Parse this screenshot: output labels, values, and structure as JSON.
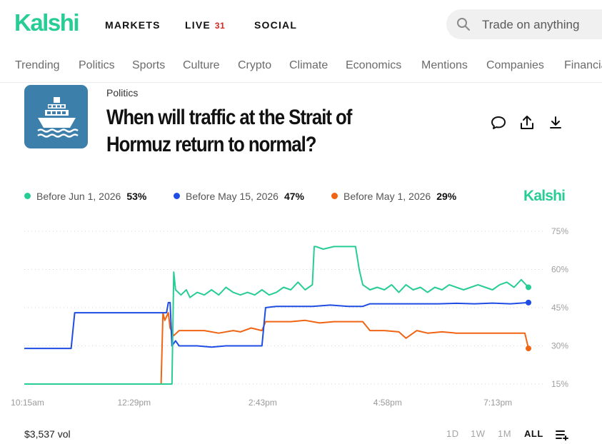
{
  "header": {
    "logo": "Kalshi",
    "nav": [
      {
        "label": "MARKETS"
      },
      {
        "label": "LIVE",
        "count": "31"
      },
      {
        "label": "SOCIAL"
      }
    ],
    "search_placeholder": "Trade on anything"
  },
  "categories": [
    "Trending",
    "Politics",
    "Sports",
    "Culture",
    "Crypto",
    "Climate",
    "Economics",
    "Mentions",
    "Companies",
    "Financials"
  ],
  "market": {
    "category": "Politics",
    "title": "When will traffic at the Strait of Hormuz return to normal?",
    "icon": "ship-icon",
    "actions": [
      "comment-icon",
      "share-icon",
      "download-icon"
    ]
  },
  "legend": {
    "items": [
      {
        "label": "Before Jun 1, 2026",
        "pct": "53%",
        "color": "#28cc95"
      },
      {
        "label": "Before May 15, 2026",
        "pct": "47%",
        "color": "#1f4de4"
      },
      {
        "label": "Before May 1, 2026",
        "pct": "29%",
        "color": "#f06414"
      }
    ],
    "brand": "Kalshi"
  },
  "chart_data": {
    "type": "line",
    "y_ticks": [
      15,
      30,
      45,
      60,
      75
    ],
    "y_tick_labels": [
      "15%",
      "30%",
      "45%",
      "60%",
      "75%"
    ],
    "ylim": [
      15,
      75
    ],
    "x_ticks": [
      {
        "label": "10:15am",
        "x": 0.09
      },
      {
        "label": "12:29pm",
        "x": 3.05
      },
      {
        "label": "2:43pm",
        "x": 6.62
      },
      {
        "label": "4:58pm",
        "x": 10.09
      },
      {
        "label": "7:13pm",
        "x": 13.15
      }
    ],
    "xlim": [
      0,
      14
    ],
    "series": [
      {
        "name": "Before Jun 1, 2026",
        "color": "#28cc95",
        "x": [
          0,
          3.9,
          4.1,
          4.15,
          4.2,
          4.35,
          4.5,
          4.6,
          4.8,
          5.0,
          5.2,
          5.4,
          5.6,
          5.8,
          6.0,
          6.2,
          6.4,
          6.6,
          6.8,
          7.0,
          7.2,
          7.4,
          7.6,
          7.8,
          8.0,
          8.05,
          8.1,
          8.3,
          8.6,
          8.9,
          9.2,
          9.3,
          9.4,
          9.6,
          9.8,
          10.0,
          10.2,
          10.4,
          10.6,
          10.8,
          11.0,
          11.2,
          11.4,
          11.6,
          11.8,
          12.0,
          12.2,
          12.4,
          12.6,
          12.8,
          13.0,
          13.2,
          13.4,
          13.6,
          13.8,
          14
        ],
        "y": [
          15,
          15,
          15,
          59,
          52,
          50,
          52,
          49,
          51,
          50,
          52,
          50,
          53,
          51,
          50,
          51,
          50,
          52,
          50,
          51,
          53,
          52,
          55,
          52,
          54,
          69,
          69,
          68,
          69,
          69,
          69,
          60,
          54,
          52,
          53,
          52,
          54,
          51,
          54,
          52,
          53,
          51,
          53,
          52,
          54,
          53,
          52,
          53,
          54,
          53,
          52,
          54,
          55,
          53,
          56,
          53
        ]
      },
      {
        "name": "Before May 15, 2026",
        "color": "#1f4de4",
        "x": [
          0,
          0.2,
          0.5,
          1.0,
          1.3,
          1.4,
          1.8,
          2.4,
          3.0,
          3.6,
          3.95,
          4.0,
          4.05,
          4.1,
          4.2,
          4.3,
          4.5,
          4.8,
          5.2,
          5.6,
          6.0,
          6.5,
          6.6,
          6.7,
          7.0,
          7.5,
          8.0,
          8.5,
          9.0,
          9.4,
          9.6,
          10.0,
          10.5,
          11.0,
          11.5,
          12.0,
          12.5,
          13.0,
          13.5,
          14
        ],
        "y": [
          29,
          29,
          29,
          29,
          29,
          43,
          43,
          43,
          43,
          43,
          43,
          47,
          47,
          30,
          32,
          30,
          30,
          30,
          29.5,
          30,
          30,
          30,
          30,
          45,
          45.5,
          45.5,
          45.5,
          46,
          45.5,
          45.5,
          46.5,
          46.5,
          46.5,
          46.5,
          46.5,
          46.7,
          46.5,
          46.8,
          46.5,
          47
        ]
      },
      {
        "name": "Before May 1, 2026",
        "color": "#f06414",
        "x": [
          0,
          3.8,
          3.85,
          3.9,
          4.0,
          4.05,
          4.15,
          4.3,
          4.6,
          5.0,
          5.4,
          5.8,
          6.0,
          6.3,
          6.6,
          6.7,
          7.0,
          7.4,
          7.8,
          8.2,
          8.6,
          9.0,
          9.4,
          9.6,
          10.0,
          10.4,
          10.6,
          10.9,
          11.2,
          11.6,
          12.0,
          12.4,
          12.8,
          13.2,
          13.6,
          13.9,
          14
        ],
        "y": [
          15,
          15,
          43,
          40,
          43,
          37,
          34,
          36,
          36,
          36,
          35,
          36,
          35.5,
          37,
          36,
          39.5,
          39.5,
          39.5,
          40,
          39,
          39.5,
          39.5,
          39.5,
          36,
          36,
          35.5,
          33,
          36,
          35,
          35.5,
          35,
          35,
          35,
          35,
          35,
          35,
          29
        ]
      }
    ],
    "grid": true,
    "legend": "top-left"
  },
  "footer": {
    "volume": "$3,537 vol",
    "ranges": [
      "1D",
      "1W",
      "1M",
      "ALL"
    ],
    "active_range": "ALL",
    "settings_icon": "chart-settings-icon"
  }
}
